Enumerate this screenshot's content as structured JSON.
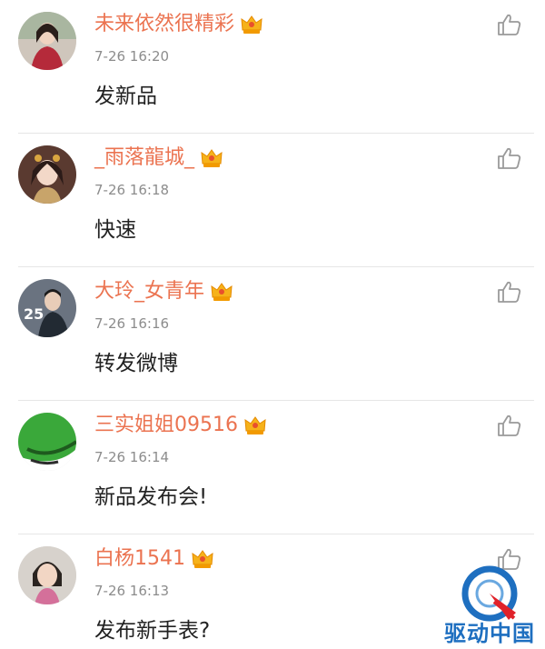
{
  "comments": [
    {
      "name": "未来依然很精彩",
      "time": "7-26 16:20",
      "text": "发新品",
      "avatar": "avatar-red-coat-woman"
    },
    {
      "name": "_雨落龍城_",
      "time": "7-26 16:18",
      "text": "快速",
      "avatar": "avatar-costume-woman"
    },
    {
      "name": "大玲_女青年",
      "time": "7-26 16:16",
      "text": "转发微博",
      "avatar": "avatar-man-25"
    },
    {
      "name": "三实姐姐09516",
      "time": "7-26 16:14",
      "text": "新品发布会!",
      "avatar": "avatar-green-leaf"
    },
    {
      "name": "白杨1541",
      "time": "7-26 16:13",
      "text": "发布新手表?",
      "avatar": "avatar-child"
    }
  ],
  "icons": {
    "like": "thumbs-up-icon",
    "vip": "crown-icon"
  },
  "colors": {
    "name": "#eb7350",
    "time": "#8c8c8c",
    "text": "#222222",
    "divider": "#e6e6e6",
    "watermark": "#1e6fc0"
  },
  "watermark": {
    "text": "驱动中国"
  }
}
